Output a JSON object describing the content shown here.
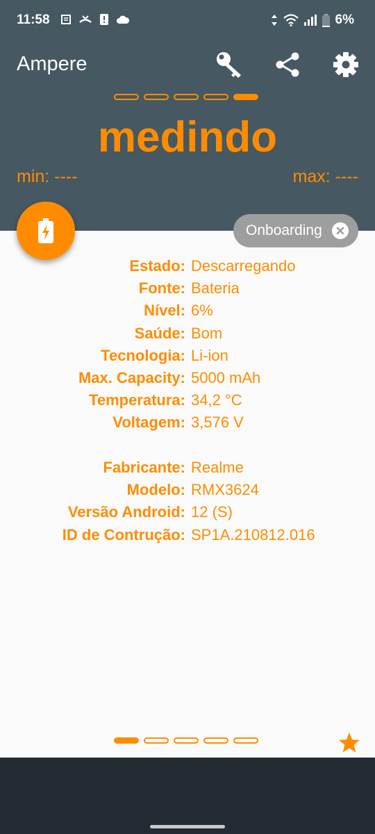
{
  "status_bar": {
    "time": "11:58",
    "battery_percent": "6%",
    "icons": [
      "notification-icon",
      "missed-call-icon",
      "sim-alert-icon",
      "cloud-icon",
      "data-arrows-icon",
      "wifi-icon",
      "signal-icon",
      "battery-icon"
    ]
  },
  "header": {
    "title": "Ampere",
    "status_word": "medindo",
    "min_label": "min: ----",
    "max_label": "max: ----",
    "actions": [
      "key-icon",
      "share-icon",
      "gear-icon"
    ],
    "page_indicator": {
      "count": 5,
      "active_index": 4
    }
  },
  "fab": {
    "icon": "battery-charging-icon"
  },
  "chip": {
    "label": "Onboarding",
    "close_icon": "close-icon"
  },
  "info_rows": [
    {
      "label": "Estado:",
      "value": "Descarregando"
    },
    {
      "label": "Fonte:",
      "value": "Bateria"
    },
    {
      "label": "Nível:",
      "value": "6%"
    },
    {
      "label": "Saúde:",
      "value": "Bom"
    },
    {
      "label": "Tecnologia:",
      "value": "Li-ion"
    },
    {
      "label": "Max. Capacity:",
      "value": "5000 mAh"
    },
    {
      "label": "Temperatura:",
      "value": "34,2 °C"
    },
    {
      "label": "Voltagem:",
      "value": "3,576 V"
    },
    {
      "label": "Fabricante:",
      "value": "Realme"
    },
    {
      "label": "Modelo:",
      "value": "RMX3624"
    },
    {
      "label": "Versão Android:",
      "value": "12 (S)"
    },
    {
      "label": "ID de Contrução:",
      "value": "SP1A.210812.016"
    }
  ],
  "bottom_indicator": {
    "count": 5,
    "active_index": 0,
    "star_icon": "star-icon"
  },
  "colors": {
    "accent": "#ff8c00",
    "header_bg": "#465861",
    "nav_bg": "#242c33",
    "chip_bg": "#9e9e9e",
    "content_bg": "#fafafa"
  }
}
